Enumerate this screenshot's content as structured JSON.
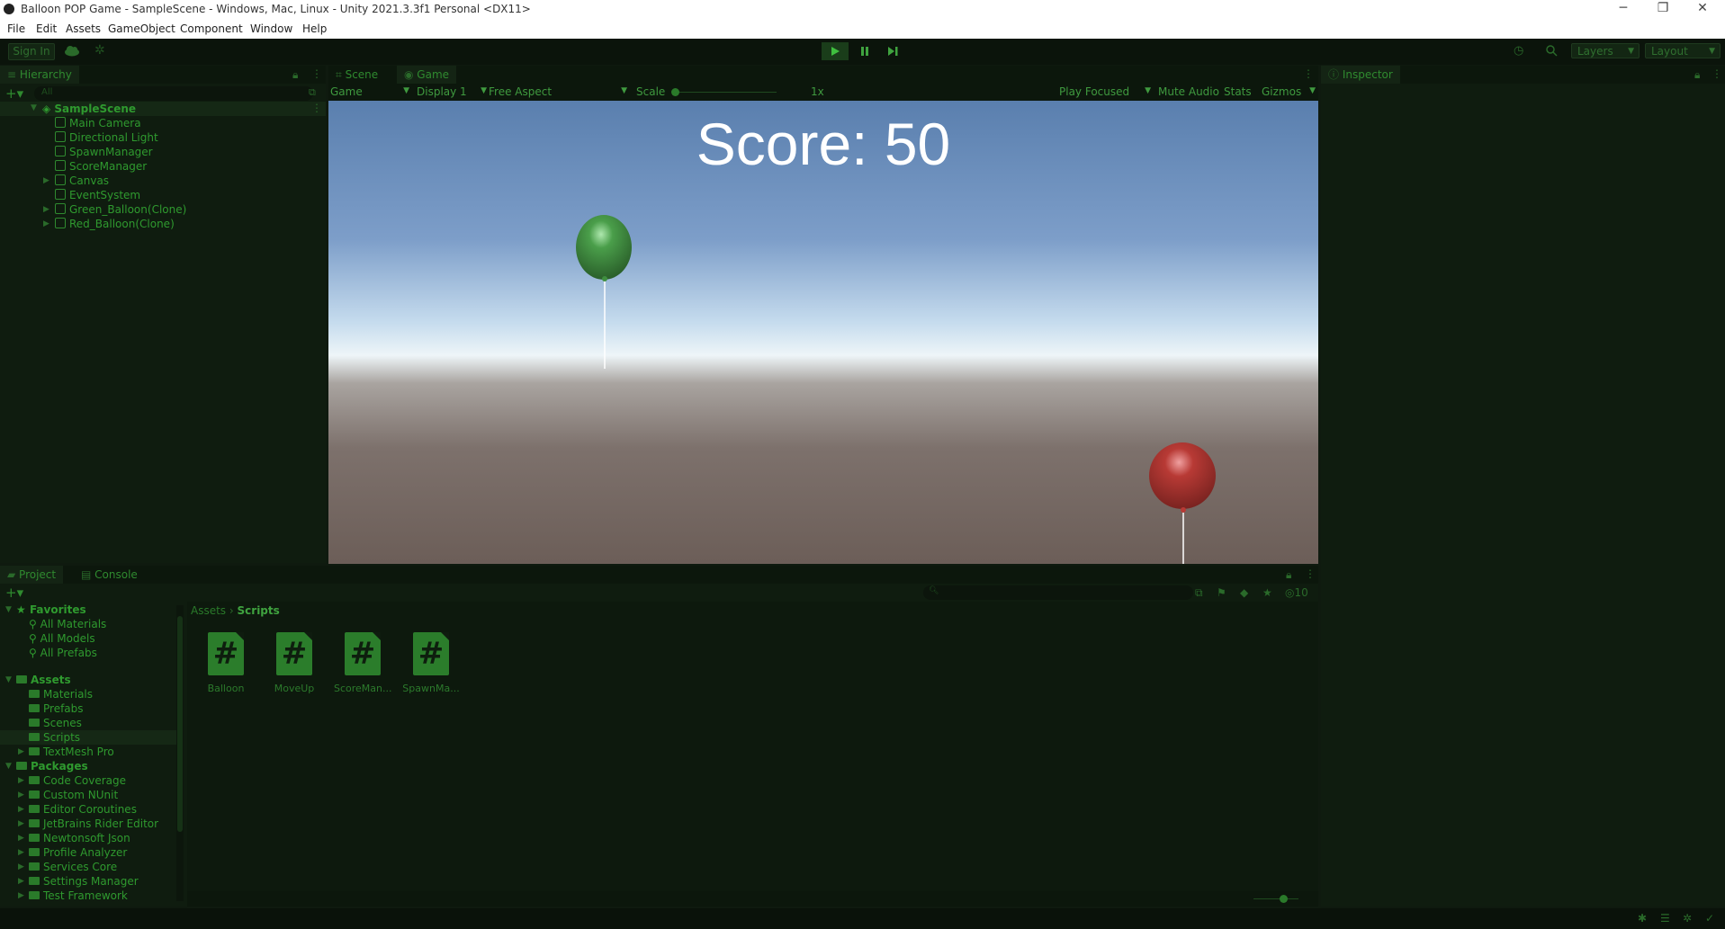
{
  "window": {
    "title": "Balloon POP Game - SampleScene - Windows, Mac, Linux - Unity 2021.3.3f1 Personal <DX11>",
    "controls": [
      "─",
      "❐",
      "✕"
    ]
  },
  "menu": [
    "File",
    "Edit",
    "Assets",
    "GameObject",
    "Component",
    "Window",
    "Help"
  ],
  "toolbar": {
    "sign_in": "Sign In",
    "play_icon": "play-icon",
    "pause_icon": "pause-icon",
    "step_icon": "step-icon",
    "layers": "Layers",
    "layout": "Layout"
  },
  "hierarchy": {
    "tab": "Hierarchy",
    "search_placeholder": "All",
    "scene": "SampleScene",
    "items": [
      {
        "label": "Main Camera",
        "expandable": false
      },
      {
        "label": "Directional Light",
        "expandable": false
      },
      {
        "label": "SpawnManager",
        "expandable": false
      },
      {
        "label": "ScoreManager",
        "expandable": false
      },
      {
        "label": "Canvas",
        "expandable": true
      },
      {
        "label": "EventSystem",
        "expandable": false
      },
      {
        "label": "Green_Balloon(Clone)",
        "expandable": true
      },
      {
        "label": "Red_Balloon(Clone)",
        "expandable": true
      }
    ]
  },
  "center_tabs": [
    "Scene",
    "Game"
  ],
  "game_toolbar": {
    "mode": "Game",
    "display": "Display 1",
    "aspect": "Free Aspect",
    "scale_label": "Scale",
    "scale_value": "1x",
    "play_focused": "Play Focused",
    "mute": "Mute Audio",
    "stats": "Stats",
    "gizmos": "Gizmos"
  },
  "game": {
    "score_text": "Score: 50",
    "balloon_colors": {
      "green": "#3f8f3f",
      "red": "#b83a35"
    }
  },
  "inspector": {
    "tab": "Inspector"
  },
  "bottom_tabs": [
    "Project",
    "Console"
  ],
  "project": {
    "favorites_header": "Favorites",
    "favorites": [
      "All Materials",
      "All Models",
      "All Prefabs"
    ],
    "assets_header": "Assets",
    "assets": [
      "Materials",
      "Prefabs",
      "Scenes",
      "Scripts",
      "TextMesh Pro"
    ],
    "packages_header": "Packages",
    "packages": [
      "Code Coverage",
      "Custom NUnit",
      "Editor Coroutines",
      "JetBrains Rider Editor",
      "Newtonsoft Json",
      "Profile Analyzer",
      "Services Core",
      "Settings Manager",
      "Test Framework"
    ],
    "breadcrumb": [
      "Assets",
      "Scripts"
    ],
    "hidden_count": "10",
    "files": [
      "Balloon",
      "MoveUp",
      "ScoreMan...",
      "SpawnMa..."
    ]
  },
  "accent_color": "#2f9a2f"
}
